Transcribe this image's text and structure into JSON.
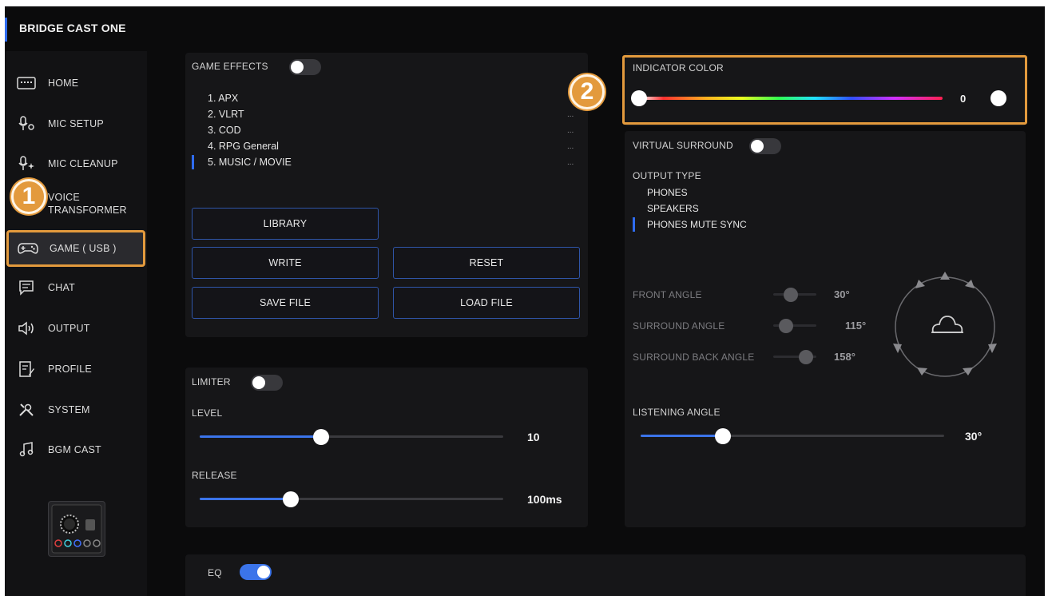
{
  "app": {
    "title": "BRIDGE CAST ONE"
  },
  "sidebar": {
    "items": [
      {
        "label": "HOME",
        "icon": "keyboard-icon"
      },
      {
        "label": "MIC SETUP",
        "icon": "mic-gear-icon"
      },
      {
        "label": "MIC CLEANUP",
        "icon": "mic-sparkle-icon"
      },
      {
        "label": "VOICE TRANSFORMER",
        "label_line1": "VOICE",
        "label_line2": "TRANSFORMER",
        "icon": "voice-transformer-icon"
      },
      {
        "label": "GAME ( USB )",
        "icon": "gamepad-icon",
        "active": true
      },
      {
        "label": "CHAT",
        "icon": "chat-icon"
      },
      {
        "label": "OUTPUT",
        "icon": "speaker-icon"
      },
      {
        "label": "PROFILE",
        "icon": "profile-icon"
      },
      {
        "label": "SYSTEM",
        "icon": "tools-icon"
      },
      {
        "label": "BGM CAST",
        "icon": "music-note-icon"
      }
    ]
  },
  "callouts": {
    "one": "1",
    "two": "2"
  },
  "game_effects": {
    "label": "GAME EFFECTS",
    "enabled": false,
    "presets": [
      {
        "label": "1. APX",
        "more": ""
      },
      {
        "label": "2. VLRT",
        "more": "..."
      },
      {
        "label": "3. COD",
        "more": "..."
      },
      {
        "label": "4. RPG General",
        "more": "..."
      },
      {
        "label": "5. MUSIC / MOVIE",
        "more": "...",
        "selected": true
      }
    ],
    "buttons": {
      "library": "LIBRARY",
      "write": "WRITE",
      "reset": "RESET",
      "save_file": "SAVE FILE",
      "load_file": "LOAD FILE"
    }
  },
  "indicator_color": {
    "label": "INDICATOR COLOR",
    "value": "0",
    "fraction": 0
  },
  "virtual_surround": {
    "label": "VIRTUAL SURROUND",
    "enabled": false,
    "output_type_label": "OUTPUT TYPE",
    "output_types": [
      "PHONES",
      "SPEAKERS",
      "PHONES MUTE SYNC"
    ],
    "selected_output": 2,
    "front_angle": {
      "label": "FRONT ANGLE",
      "value": "30°",
      "fraction": 0.4
    },
    "surround_angle": {
      "label": "SURROUND ANGLE",
      "value": "115°",
      "fraction": 0.3
    },
    "surround_back_angle": {
      "label": "SURROUND BACK ANGLE",
      "value": "158°",
      "fraction": 0.75
    },
    "listening_angle": {
      "label": "LISTENING ANGLE",
      "value": "30°",
      "fraction": 0.27
    }
  },
  "limiter": {
    "label": "LIMITER",
    "enabled": false,
    "level": {
      "label": "LEVEL",
      "value": "10",
      "fraction": 0.4
    },
    "release": {
      "label": "RELEASE",
      "value": "100ms",
      "fraction": 0.3
    }
  },
  "eq": {
    "label": "EQ",
    "enabled": true
  },
  "colors": {
    "accent": "#3b74ea",
    "highlight": "#e39a3d",
    "background": "#0b0b0c",
    "panel": "#161618"
  }
}
